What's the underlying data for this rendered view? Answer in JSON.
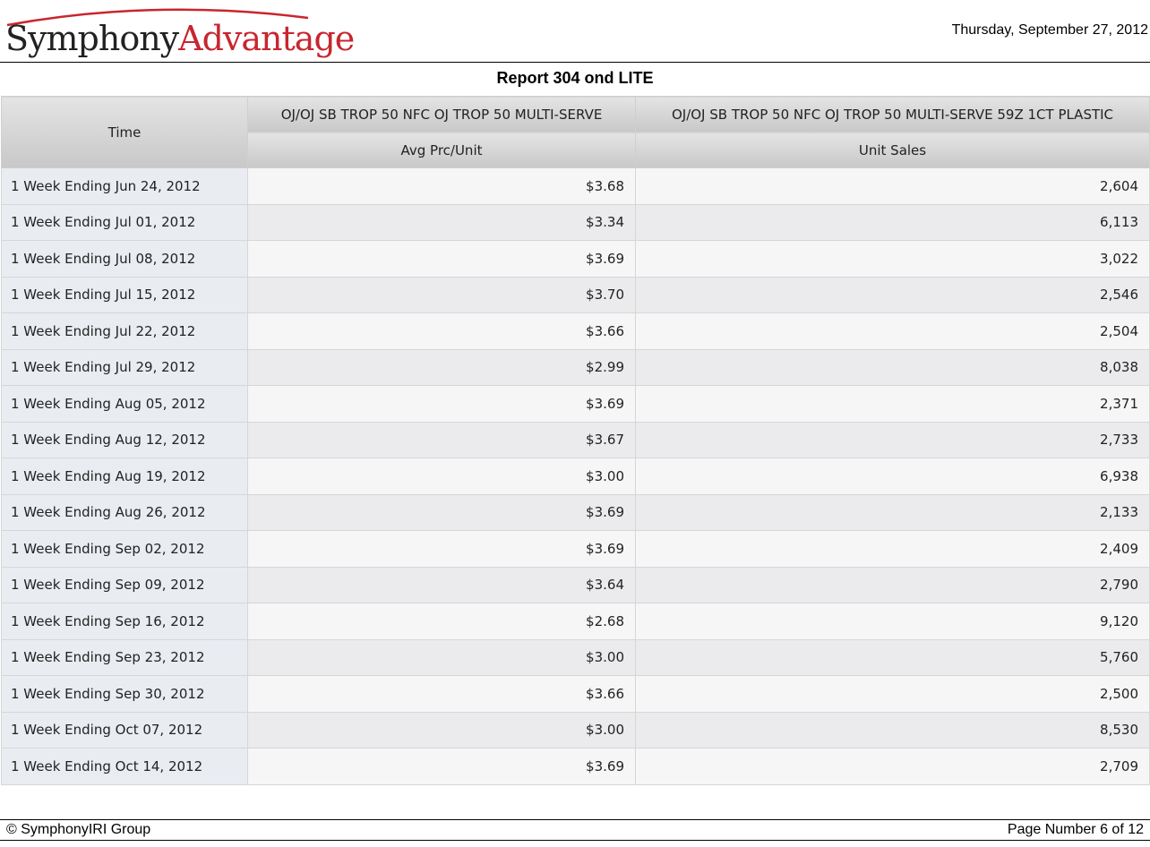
{
  "header": {
    "logo_part1": "Symphony",
    "logo_part2": "Advantage",
    "date": "Thursday, September 27, 2012"
  },
  "title": "Report 304 ond LITE",
  "table": {
    "time_header": "Time",
    "col1_group": "OJ/OJ SB TROP 50 NFC OJ TROP 50 MULTI-SERVE",
    "col2_group": "OJ/OJ SB TROP 50 NFC OJ TROP 50 MULTI-SERVE 59Z 1CT PLASTIC",
    "col1_measure": "Avg Prc/Unit",
    "col2_measure": "Unit Sales",
    "rows": [
      {
        "time": "1 Week Ending Jun 24, 2012",
        "avg": "$3.68",
        "units": "2,604"
      },
      {
        "time": "1 Week Ending Jul 01, 2012",
        "avg": "$3.34",
        "units": "6,113"
      },
      {
        "time": "1 Week Ending Jul 08, 2012",
        "avg": "$3.69",
        "units": "3,022"
      },
      {
        "time": "1 Week Ending Jul 15, 2012",
        "avg": "$3.70",
        "units": "2,546"
      },
      {
        "time": "1 Week Ending Jul 22, 2012",
        "avg": "$3.66",
        "units": "2,504"
      },
      {
        "time": "1 Week Ending Jul 29, 2012",
        "avg": "$2.99",
        "units": "8,038"
      },
      {
        "time": "1 Week Ending Aug 05, 2012",
        "avg": "$3.69",
        "units": "2,371"
      },
      {
        "time": "1 Week Ending Aug 12, 2012",
        "avg": "$3.67",
        "units": "2,733"
      },
      {
        "time": "1 Week Ending Aug 19, 2012",
        "avg": "$3.00",
        "units": "6,938"
      },
      {
        "time": "1 Week Ending Aug 26, 2012",
        "avg": "$3.69",
        "units": "2,133"
      },
      {
        "time": "1 Week Ending Sep 02, 2012",
        "avg": "$3.69",
        "units": "2,409"
      },
      {
        "time": "1 Week Ending Sep 09, 2012",
        "avg": "$3.64",
        "units": "2,790"
      },
      {
        "time": "1 Week Ending Sep 16, 2012",
        "avg": "$2.68",
        "units": "9,120"
      },
      {
        "time": "1 Week Ending Sep 23, 2012",
        "avg": "$3.00",
        "units": "5,760"
      },
      {
        "time": "1 Week Ending Sep 30, 2012",
        "avg": "$3.66",
        "units": "2,500"
      },
      {
        "time": "1 Week Ending Oct 07, 2012",
        "avg": "$3.00",
        "units": "8,530"
      },
      {
        "time": "1 Week Ending Oct 14, 2012",
        "avg": "$3.69",
        "units": "2,709"
      }
    ]
  },
  "footer": {
    "copyright": "© SymphonyIRI Group",
    "page_number": "Page Number 6 of 12"
  },
  "colors": {
    "logo_red": "#c8262f",
    "logo_dark": "#222222",
    "time_cell_bg": "#e9edf2"
  }
}
